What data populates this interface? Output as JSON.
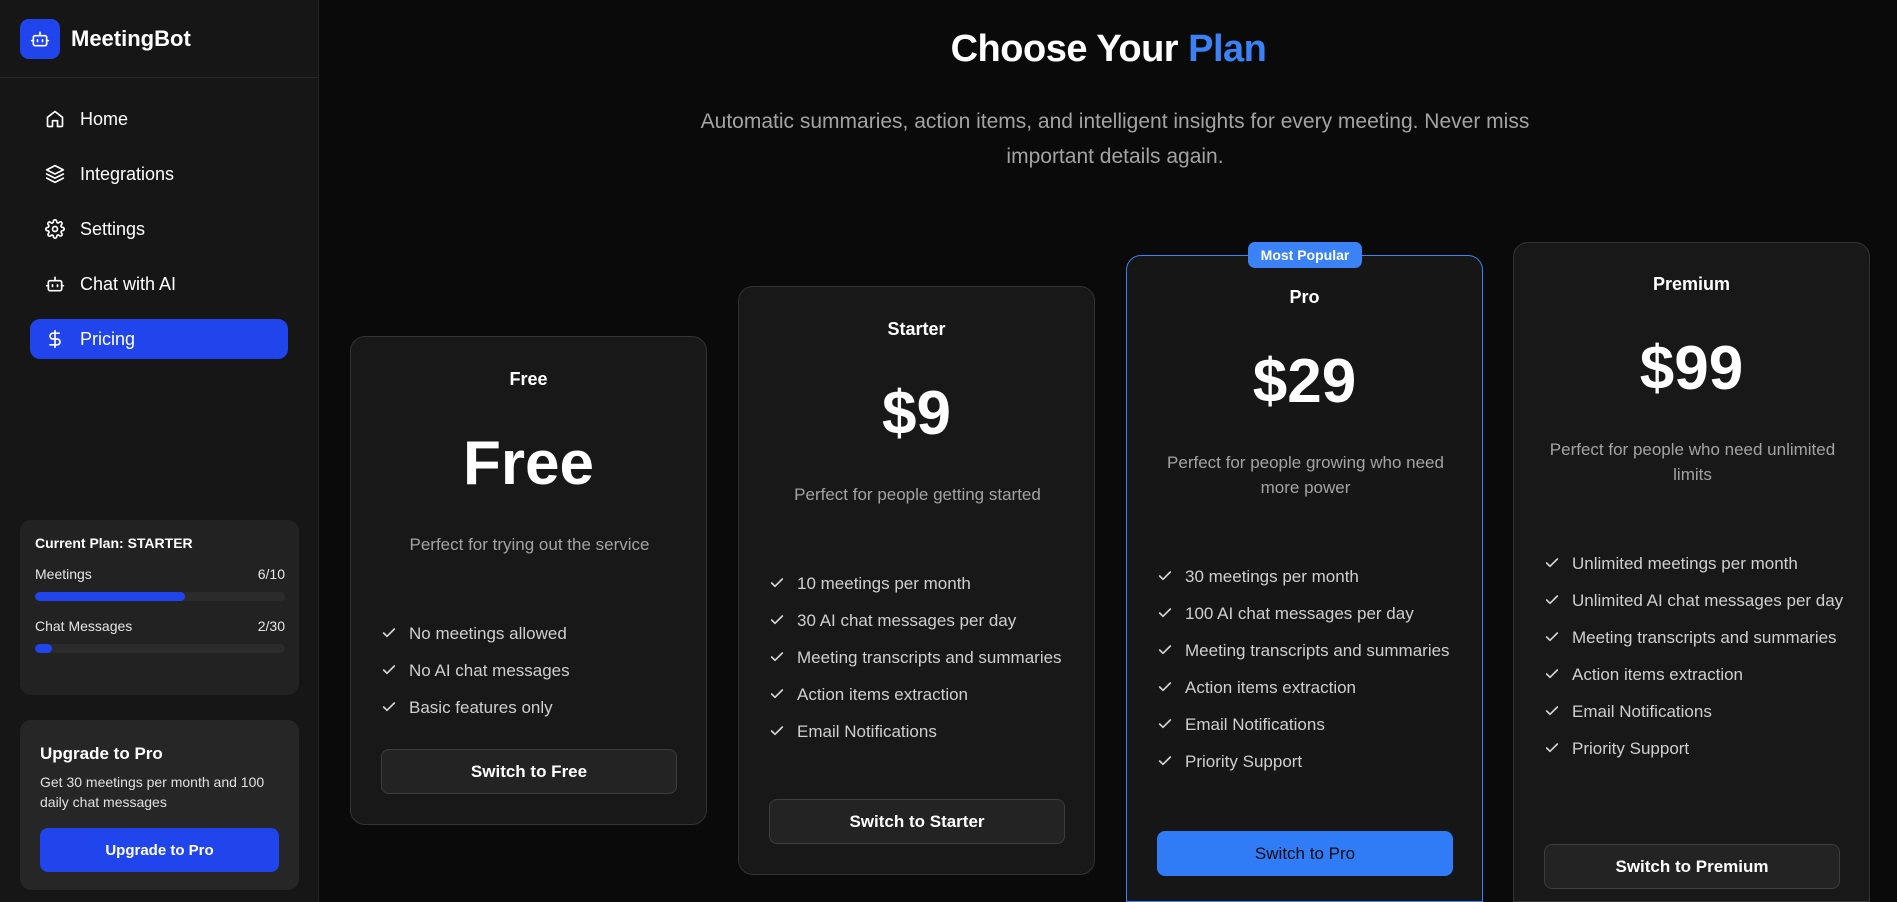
{
  "app": {
    "name": "MeetingBot"
  },
  "nav": [
    {
      "label": "Home",
      "icon": "home-icon"
    },
    {
      "label": "Integrations",
      "icon": "layers-icon"
    },
    {
      "label": "Settings",
      "icon": "gear-icon"
    },
    {
      "label": "Chat with AI",
      "icon": "robot-icon"
    },
    {
      "label": "Pricing",
      "icon": "dollar-icon",
      "active": true
    }
  ],
  "current_plan": {
    "title": "Current Plan: STARTER",
    "meetings": {
      "label": "Meetings",
      "value": "6/10",
      "fraction": 0.6
    },
    "chat": {
      "label": "Chat Messages",
      "value": "2/30",
      "fraction": 0.067
    }
  },
  "upgrade": {
    "title": "Upgrade to Pro",
    "desc": "Get 30 meetings per month and 100 daily chat messages",
    "button": "Upgrade to Pro"
  },
  "page": {
    "heading_main": "Choose Your ",
    "heading_accent": "Plan",
    "subheading": "Automatic summaries, action items, and intelligent insights for every meeting. Never miss important details again."
  },
  "plans": [
    {
      "name": "Free",
      "price": "Free",
      "desc": "Perfect for trying out the service",
      "features": [
        "No meetings allowed",
        "No AI chat messages",
        "Basic features only"
      ],
      "button": "Switch to Free"
    },
    {
      "name": "Starter",
      "price": "$9",
      "desc": "Perfect for people getting started",
      "features": [
        "10 meetings per month",
        "30 AI chat messages per day",
        "Meeting transcripts and summaries",
        "Action items extraction",
        "Email Notifications"
      ],
      "button": "Switch to Starter"
    },
    {
      "name": "Pro",
      "price": "$29",
      "badge": "Most Popular",
      "desc": "Perfect for people growing who need more power",
      "features": [
        "30 meetings per month",
        "100 AI chat messages per day",
        "Meeting transcripts and summaries",
        "Action items extraction",
        "Email Notifications",
        "Priority Support"
      ],
      "button": "Switch to Pro"
    },
    {
      "name": "Premium",
      "price": "$99",
      "desc": "Perfect for people who need unlimited limits",
      "features": [
        "Unlimited meetings per month",
        "Unlimited AI chat messages per day",
        "Meeting transcripts and summaries",
        "Action items extraction",
        "Email Notifications",
        "Priority Support"
      ],
      "button": "Switch to Premium"
    }
  ],
  "colors": {
    "accent": "#2145ec",
    "highlight": "#3b82f6"
  }
}
